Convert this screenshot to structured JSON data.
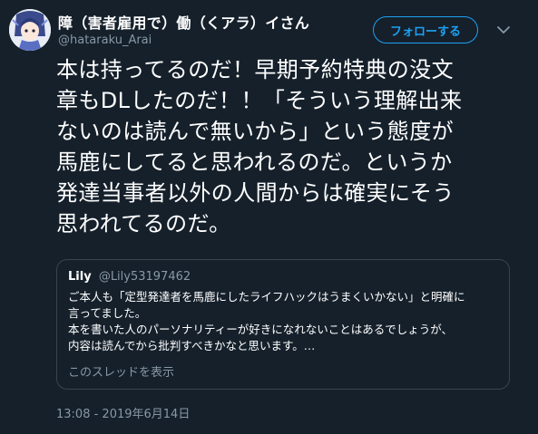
{
  "author": {
    "display_name": "障（害者雇用で）働（くアラ）イさん",
    "handle": "@hataraku_Arai",
    "avatar": "avatar-image"
  },
  "header": {
    "follow_label": "フォローする",
    "menu_icon": "chevron-down-icon"
  },
  "tweet": {
    "lines": [
      "本は持ってるのだ！早期予約特典の没文",
      "章もDLしたのだ！！「そういう理解出来",
      "ないのは読んで無いから」という態度が",
      "馬鹿にしてると思われるのだ。というか",
      "発達当事者以外の人間からは確実にそう",
      "思われてるのだ。"
    ],
    "timestamp": "13:08 - 2019年6月14日"
  },
  "quote": {
    "name": "Lily",
    "handle": "@Lily53197462",
    "lines": [
      "ご本人も「定型発達者を馬鹿にしたライフハックはうまくいかない」と明確に",
      "言ってました。",
      "本を書いた人のパーソナリティーが好きになれないことはあるでしょうが、",
      "内容は読んでから批判すべきかなと思います。…"
    ],
    "show_thread_label": "このスレッドを表示"
  },
  "colors": {
    "background": "#15202b",
    "accent": "#1da1f2",
    "secondary_text": "#8899a6",
    "border": "#38444d"
  }
}
